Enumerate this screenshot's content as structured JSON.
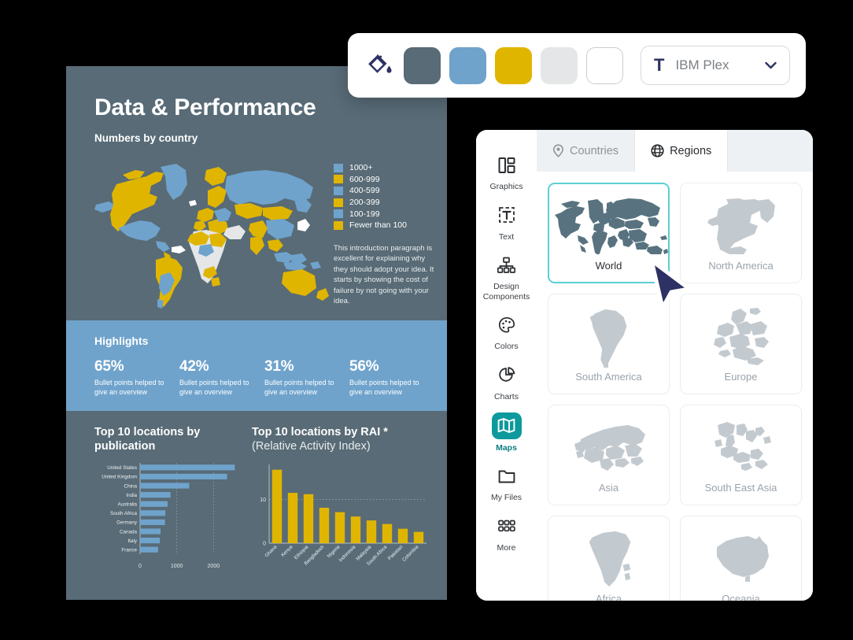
{
  "toolbar": {
    "fill_icon": "paint-bucket-icon",
    "swatches": [
      {
        "name": "slate",
        "color": "#586b76"
      },
      {
        "name": "blue",
        "color": "#6fa3cc"
      },
      {
        "name": "gold",
        "color": "#e0b500"
      },
      {
        "name": "light-gray",
        "color": "#e4e6e8"
      },
      {
        "name": "white",
        "color": "#ffffff"
      }
    ],
    "font": {
      "glyph": "T",
      "name": "IBM Plex",
      "caret": "⌄"
    }
  },
  "infographic": {
    "title": "Data & Performance",
    "subtitle": "Numbers by country",
    "legend": [
      {
        "label": "1000+",
        "color": "#6fa3cc"
      },
      {
        "label": "600-999",
        "color": "#e0b500"
      },
      {
        "label": "400-599",
        "color": "#6fa3cc"
      },
      {
        "label": "200-399",
        "color": "#e0b500"
      },
      {
        "label": "100-199",
        "color": "#6fa3cc"
      },
      {
        "label": "Fewer than 100",
        "color": "#e0b500"
      }
    ],
    "intro_paragraph": "This introduction paragraph is excellent for explaining why they should adopt your idea. It starts by showing the cost of failure by not going with your idea.",
    "highlights": {
      "title": "Highlights",
      "items": [
        {
          "percent": "65%",
          "desc": "Bullet points helped to give an overview"
        },
        {
          "percent": "42%",
          "desc": "Bullet points helped to give an overview"
        },
        {
          "percent": "31%",
          "desc": "Bullet points helped to give an overview"
        },
        {
          "percent": "56%",
          "desc": "Bullet points helped to give an overview"
        }
      ]
    },
    "chart_left_title": "Top 10 locations by publication",
    "chart_right_title": "Top 10 locations by RAI *",
    "chart_right_subtitle": "(Relative Activity Index)"
  },
  "chart_data": [
    {
      "type": "bar",
      "orientation": "horizontal",
      "title": "Top 10 locations by publication",
      "categories": [
        "United States",
        "United Kingdom",
        "China",
        "India",
        "Australia",
        "South Africa",
        "Germany",
        "Canada",
        "Italy",
        "France"
      ],
      "values": [
        2580,
        2370,
        1340,
        830,
        750,
        690,
        680,
        560,
        540,
        490
      ],
      "xlabel": "",
      "ylabel": "",
      "xticks": [
        "0",
        "1000",
        "2000"
      ],
      "xlim": [
        0,
        2700
      ],
      "grid": true,
      "color": "#6fa3cc"
    },
    {
      "type": "bar",
      "orientation": "vertical",
      "title": "Top 10 locations by RAI * (Relative Activity Index)",
      "categories": [
        "Ghana",
        "Kenya",
        "Ethiopia",
        "Bangladesh",
        "Nigeria",
        "Indonesia",
        "Malaysia",
        "South Africa",
        "Pakistan",
        "Colombia"
      ],
      "values": [
        16.8,
        11.5,
        11.2,
        8.1,
        7.1,
        6.1,
        5.2,
        4.4,
        3.3,
        2.6
      ],
      "xlabel": "",
      "ylabel": "",
      "yticks": [
        "0",
        "10"
      ],
      "ylim": [
        0,
        18
      ],
      "grid": true,
      "color": "#e0b500"
    }
  ],
  "panel": {
    "rail": [
      {
        "label": "Graphics",
        "icon": "graphics-icon",
        "active": false
      },
      {
        "label": "Text",
        "icon": "text-icon",
        "active": false
      },
      {
        "label": "Design Components",
        "icon": "design-components-icon",
        "active": false
      },
      {
        "label": "Colors",
        "icon": "palette-icon",
        "active": false
      },
      {
        "label": "Charts",
        "icon": "pie-chart-icon",
        "active": false
      },
      {
        "label": "Maps",
        "icon": "map-icon",
        "active": true
      },
      {
        "label": "My Files",
        "icon": "folder-icon",
        "active": false
      },
      {
        "label": "More",
        "icon": "grid-dots-icon",
        "active": false
      }
    ],
    "tabs": [
      {
        "label": "Countries",
        "icon": "location-pin-icon",
        "active": false
      },
      {
        "label": "Regions",
        "icon": "globe-icon",
        "active": true
      }
    ],
    "maps": [
      {
        "label": "World",
        "selected": true
      },
      {
        "label": "North America",
        "selected": false
      },
      {
        "label": "South America",
        "selected": false
      },
      {
        "label": "Europe",
        "selected": false
      },
      {
        "label": "Asia",
        "selected": false
      },
      {
        "label": "South East Asia",
        "selected": false
      },
      {
        "label": "Africa",
        "selected": false
      },
      {
        "label": "Oceania",
        "selected": false
      }
    ],
    "accent_color": "#0e9a9c",
    "selection_color": "#5ccfd3"
  },
  "cursor": {
    "name": "mouse-pointer",
    "color": "#2e3163"
  }
}
